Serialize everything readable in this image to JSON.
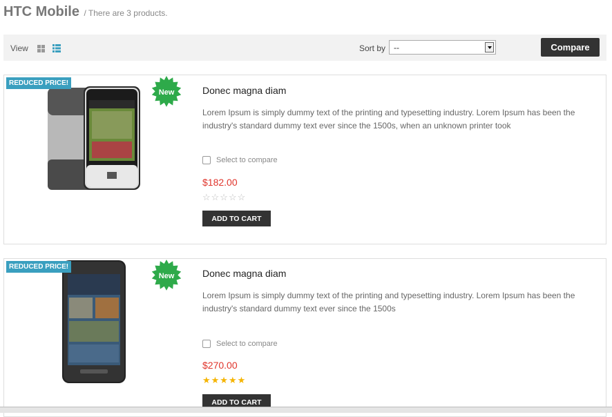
{
  "header": {
    "title": "HTC Mobile",
    "subtitle": "/ There are 3 products."
  },
  "toolbar": {
    "view_label": "View",
    "grid_icon": "grid-view-icon",
    "list_icon": "list-view-icon",
    "sort_label": "Sort by",
    "sort_value": "--",
    "compare_label": "Compare"
  },
  "products": [
    {
      "ribbon": "REDUCED PRICE!",
      "badge": "New",
      "name": "Donec magna diam",
      "description": "Lorem Ipsum is simply dummy text of the printing and typesetting industry. Lorem Ipsum has been the industry's standard dummy text ever since the 1500s, when an unknown printer took",
      "compare_label": "Select to compare",
      "price": "$182.00",
      "rating": 0,
      "stars": "☆☆☆☆☆",
      "cart_label": "ADD TO CART"
    },
    {
      "ribbon": "REDUCED PRICE!",
      "badge": "New",
      "name": "Donec magna diam",
      "description": "Lorem Ipsum is simply dummy text of the printing and typesetting industry. Lorem Ipsum has been the industry's standard dummy text ever since the 1500s",
      "compare_label": "Select to compare",
      "price": "$270.00",
      "rating": 5,
      "stars": "★★★★★",
      "cart_label": "ADD TO CART"
    }
  ],
  "colors": {
    "accent": "#3a9fbf",
    "price": "#e0342b",
    "badge": "#2eaa4a",
    "star": "#f5b400"
  }
}
